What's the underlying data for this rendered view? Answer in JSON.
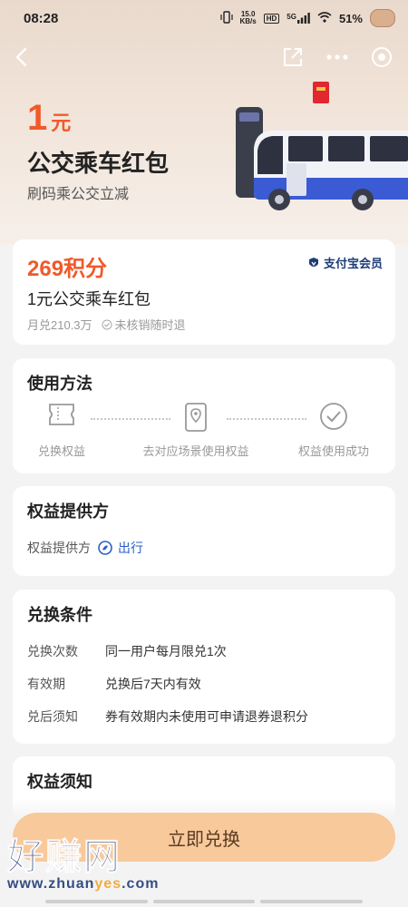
{
  "status_bar": {
    "time": "08:28",
    "speed_value": "15.0",
    "speed_unit": "KB/s",
    "hd": "HD",
    "network": "5G",
    "battery": "51%"
  },
  "hero": {
    "price": "1",
    "unit": "元",
    "title": "公交乘车红包",
    "subtitle": "刷码乘公交立减"
  },
  "product": {
    "points": "269积分",
    "brand": "支付宝会员",
    "name": "1元公交乘车红包",
    "monthly": "月兑210.3万",
    "refund": "未核销随时退"
  },
  "usage": {
    "title": "使用方法",
    "steps": [
      {
        "label": "兑换权益",
        "icon": "ticket-icon"
      },
      {
        "label": "去对应场景使用权益",
        "icon": "location-pin-icon"
      },
      {
        "label": "权益使用成功",
        "icon": "check-circle-icon"
      }
    ]
  },
  "provider": {
    "title": "权益提供方",
    "key": "权益提供方",
    "value": "出行"
  },
  "conditions": {
    "title": "兑换条件",
    "rows": [
      {
        "key": "兑换次数",
        "value": "同一用户每月限兑1次"
      },
      {
        "key": "有效期",
        "value": "兑换后7天内有效"
      },
      {
        "key": "兑后须知",
        "value": "券有效期内未使用可申请退券退积分"
      }
    ]
  },
  "notice": {
    "title": "权益须知"
  },
  "cta": {
    "label": "立即兑换"
  },
  "watermark": {
    "cn": "好赚网",
    "en_pre": "www.zhuan",
    "en_hl": "yes",
    "en_post": ".com"
  },
  "colors": {
    "accent": "#f05a2a",
    "cta_bg": "#f7c99b",
    "link": "#2d5ec9",
    "card_bg": "#ffffff",
    "page_bg": "#f4f3f3"
  }
}
